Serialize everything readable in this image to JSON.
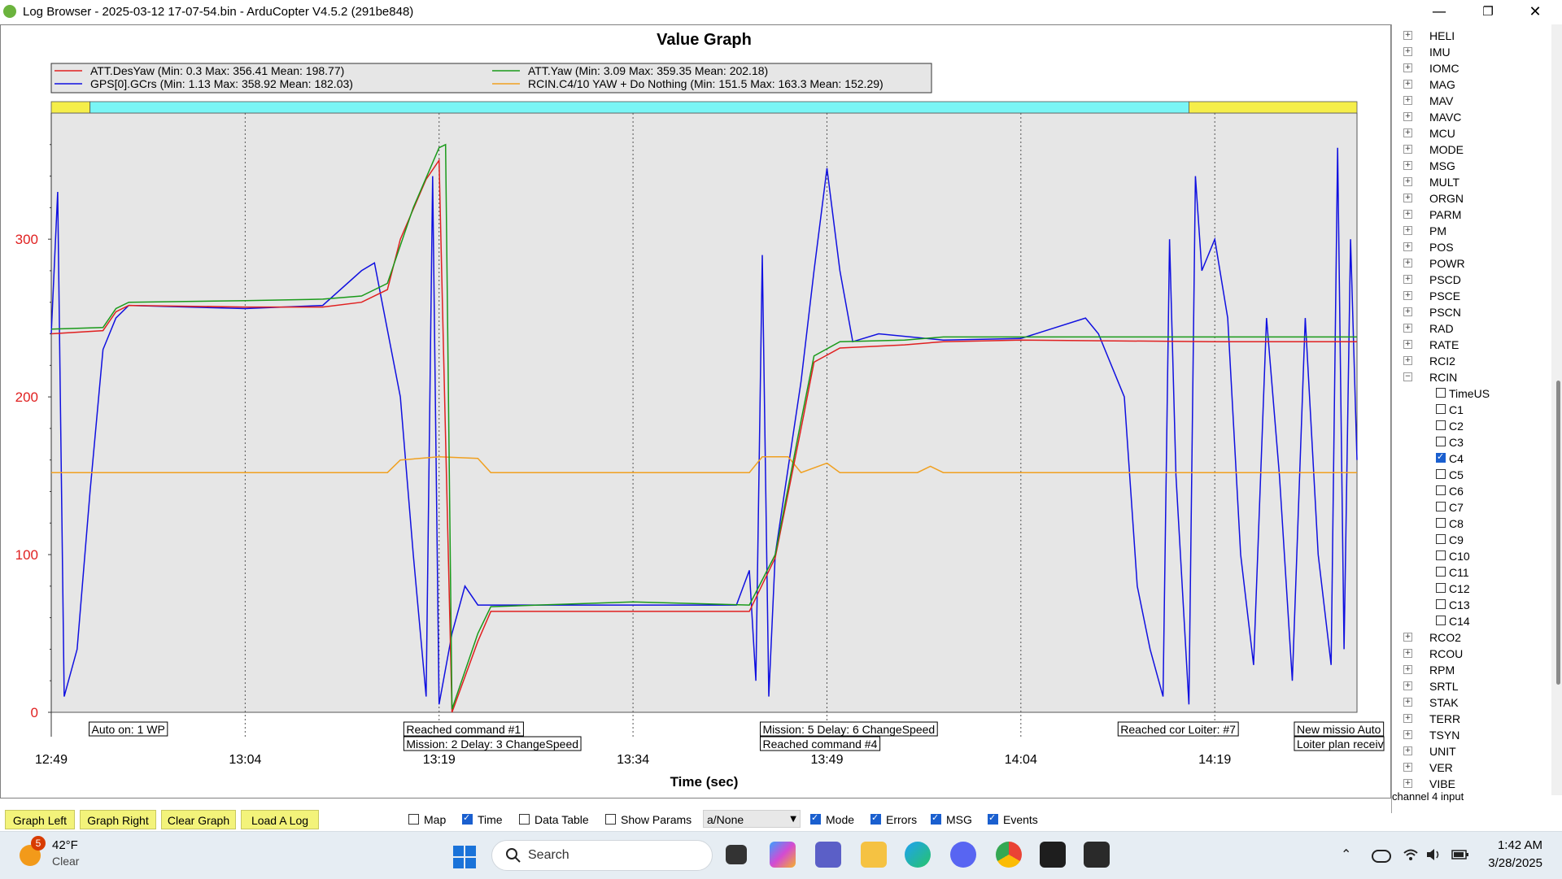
{
  "window": {
    "title": "Log Browser - 2025-03-12 17-07-54.bin - ArduCopter V4.5.2 (291be848)",
    "minimize": "—",
    "maximize": "❐",
    "close": "✕"
  },
  "graph": {
    "title": "Value Graph",
    "xlabel": "Time (sec)",
    "legend": [
      {
        "label": "ATT.DesYaw  (Min: 0.3 Max: 356.41 Mean: 198.77)",
        "color": "#e02020"
      },
      {
        "label": "ATT.Yaw  (Min: 3.09 Max: 359.35 Mean: 202.18)",
        "color": "#1a9a1a"
      },
      {
        "label": "GPS[0].GCrs  (Min: 1.13 Max: 358.92 Mean: 182.03)",
        "color": "#1010e0"
      },
      {
        "label": "RCIN.C4/10 YAW + Do Nothing (Min: 151.5 Max: 163.3 Mean: 152.29)",
        "color": "#f0a020"
      }
    ],
    "annotations": [
      {
        "lines": [
          "Auto on: 1 WP"
        ],
        "x": 0.029
      },
      {
        "lines": [
          "Reached command #1",
          "Mission: 2 Delay: 3 ChangeSpeed"
        ],
        "x": 0.27
      },
      {
        "lines": [
          "Mission: 5 Delay: 6 ChangeSpeed",
          "Reached command #4"
        ],
        "x": 0.543
      },
      {
        "lines": [
          "Reached cor Loiter: #7"
        ],
        "x": 0.817
      },
      {
        "lines": [
          "New missio Auto",
          "Loiter plan receiv"
        ],
        "x": 0.952
      }
    ]
  },
  "chart_data": {
    "type": "line",
    "title": "Value Graph",
    "xlabel": "Time (sec)",
    "ylabel": "",
    "x_ticks": [
      "12:49",
      "13:04",
      "13:19",
      "13:34",
      "13:49",
      "14:04",
      "14:19"
    ],
    "y_ticks": [
      0,
      100,
      200,
      300
    ],
    "xlim": [
      "12:49",
      "14:30"
    ],
    "ylim": [
      0,
      380
    ],
    "grid": "vertical dotted",
    "mode_bar": [
      {
        "from": "12:49",
        "to": "12:52",
        "color": "#f5ee4a"
      },
      {
        "from": "12:52",
        "to": "14:17",
        "color": "#7af5f5"
      },
      {
        "from": "14:17",
        "to": "14:30",
        "color": "#f5ee4a"
      }
    ],
    "series": [
      {
        "name": "ATT.DesYaw",
        "color": "#e02020",
        "points": [
          [
            "12:49",
            240
          ],
          [
            "12:53",
            242
          ],
          [
            "12:54",
            254
          ],
          [
            "12:55",
            258
          ],
          [
            "13:04",
            257
          ],
          [
            "13:10",
            257
          ],
          [
            "13:13",
            260
          ],
          [
            "13:15",
            268
          ],
          [
            "13:16",
            300
          ],
          [
            "13:18",
            338
          ],
          [
            "13:19",
            350
          ],
          [
            "13:20",
            0
          ],
          [
            "13:22",
            45
          ],
          [
            "13:23",
            64
          ],
          [
            "13:34",
            64
          ],
          [
            "13:43",
            64
          ],
          [
            "13:45",
            98
          ],
          [
            "13:47",
            180
          ],
          [
            "13:48",
            222
          ],
          [
            "13:50",
            231
          ],
          [
            "13:55",
            233
          ],
          [
            "13:58",
            235
          ],
          [
            "14:04",
            236
          ],
          [
            "14:19",
            235
          ],
          [
            "14:30",
            235
          ]
        ]
      },
      {
        "name": "ATT.Yaw",
        "color": "#1a9a1a",
        "points": [
          [
            "12:49",
            243
          ],
          [
            "12:53",
            244
          ],
          [
            "12:54",
            256
          ],
          [
            "12:55",
            260
          ],
          [
            "13:04",
            261
          ],
          [
            "13:10",
            262
          ],
          [
            "13:13",
            264
          ],
          [
            "13:15",
            272
          ],
          [
            "13:17",
            320
          ],
          [
            "13:19",
            358
          ],
          [
            "13:19.5",
            360
          ],
          [
            "13:20",
            2
          ],
          [
            "13:22",
            50
          ],
          [
            "13:23",
            67
          ],
          [
            "13:34",
            70
          ],
          [
            "13:43",
            68
          ],
          [
            "13:45",
            100
          ],
          [
            "13:47",
            185
          ],
          [
            "13:48",
            226
          ],
          [
            "13:50",
            235
          ],
          [
            "13:55",
            236
          ],
          [
            "13:58",
            238
          ],
          [
            "14:04",
            238
          ],
          [
            "14:19",
            238
          ],
          [
            "14:30",
            238
          ]
        ]
      },
      {
        "name": "GPS[0].GCrs",
        "color": "#1010e0",
        "points": [
          [
            "12:49",
            240
          ],
          [
            "12:49.5",
            330
          ],
          [
            "12:50",
            10
          ],
          [
            "12:51",
            40
          ],
          [
            "12:52",
            140
          ],
          [
            "12:53",
            230
          ],
          [
            "12:54",
            250
          ],
          [
            "12:55",
            258
          ],
          [
            "13:04",
            256
          ],
          [
            "13:10",
            258
          ],
          [
            "13:13",
            280
          ],
          [
            "13:14",
            285
          ],
          [
            "13:16",
            200
          ],
          [
            "13:17",
            100
          ],
          [
            "13:18",
            10
          ],
          [
            "13:18.5",
            340
          ],
          [
            "13:19",
            5
          ],
          [
            "13:20",
            50
          ],
          [
            "13:21",
            80
          ],
          [
            "13:22",
            68
          ],
          [
            "13:34",
            68
          ],
          [
            "13:42",
            68
          ],
          [
            "13:43",
            90
          ],
          [
            "13:43.5",
            20
          ],
          [
            "13:44",
            290
          ],
          [
            "13:44.5",
            10
          ],
          [
            "13:45",
            100
          ],
          [
            "13:47",
            210
          ],
          [
            "13:48",
            280
          ],
          [
            "13:49",
            345
          ],
          [
            "13:50",
            280
          ],
          [
            "13:51",
            235
          ],
          [
            "13:53",
            240
          ],
          [
            "13:58",
            236
          ],
          [
            "14:04",
            237
          ],
          [
            "14:09",
            250
          ],
          [
            "14:10",
            240
          ],
          [
            "14:12",
            200
          ],
          [
            "14:13",
            80
          ],
          [
            "14:14",
            40
          ],
          [
            "14:15",
            10
          ],
          [
            "14:15.5",
            300
          ],
          [
            "14:16",
            150
          ],
          [
            "14:17",
            5
          ],
          [
            "14:17.5",
            340
          ],
          [
            "14:18",
            280
          ],
          [
            "14:19",
            300
          ],
          [
            "14:20",
            250
          ],
          [
            "14:21",
            100
          ],
          [
            "14:22",
            30
          ],
          [
            "14:23",
            250
          ],
          [
            "14:24",
            150
          ],
          [
            "14:25",
            20
          ],
          [
            "14:26",
            250
          ],
          [
            "14:27",
            100
          ],
          [
            "14:28",
            30
          ],
          [
            "14:28.5",
            358
          ],
          [
            "14:29",
            40
          ],
          [
            "14:29.5",
            300
          ],
          [
            "14:30",
            160
          ]
        ]
      },
      {
        "name": "RCIN.C4/10 YAW + Do Nothing",
        "color": "#f0a020",
        "points": [
          [
            "12:49",
            152
          ],
          [
            "13:15",
            152
          ],
          [
            "13:16",
            160
          ],
          [
            "13:19",
            162
          ],
          [
            "13:22",
            161
          ],
          [
            "13:23",
            152
          ],
          [
            "13:43",
            152
          ],
          [
            "13:44",
            162
          ],
          [
            "13:46",
            162
          ],
          [
            "13:47",
            152
          ],
          [
            "13:49",
            158
          ],
          [
            "13:50",
            152
          ],
          [
            "13:56",
            152
          ],
          [
            "13:57",
            156
          ],
          [
            "13:58",
            152
          ],
          [
            "14:19",
            152
          ],
          [
            "14:30",
            152
          ]
        ]
      }
    ]
  },
  "tree": {
    "items": [
      {
        "label": "HELI",
        "type": "node"
      },
      {
        "label": "IMU",
        "type": "node"
      },
      {
        "label": "IOMC",
        "type": "node"
      },
      {
        "label": "MAG",
        "type": "node"
      },
      {
        "label": "MAV",
        "type": "node"
      },
      {
        "label": "MAVC",
        "type": "node"
      },
      {
        "label": "MCU",
        "type": "node"
      },
      {
        "label": "MODE",
        "type": "node"
      },
      {
        "label": "MSG",
        "type": "node"
      },
      {
        "label": "MULT",
        "type": "node"
      },
      {
        "label": "ORGN",
        "type": "node"
      },
      {
        "label": "PARM",
        "type": "node"
      },
      {
        "label": "PM",
        "type": "node"
      },
      {
        "label": "POS",
        "type": "node"
      },
      {
        "label": "POWR",
        "type": "node"
      },
      {
        "label": "PSCD",
        "type": "node"
      },
      {
        "label": "PSCE",
        "type": "node"
      },
      {
        "label": "PSCN",
        "type": "node"
      },
      {
        "label": "RAD",
        "type": "node"
      },
      {
        "label": "RATE",
        "type": "node"
      },
      {
        "label": "RCI2",
        "type": "node"
      },
      {
        "label": "RCIN",
        "type": "open"
      },
      {
        "label": "TimeUS",
        "type": "leaf",
        "checked": false
      },
      {
        "label": "C1",
        "type": "leaf",
        "checked": false
      },
      {
        "label": "C2",
        "type": "leaf",
        "checked": false
      },
      {
        "label": "C3",
        "type": "leaf",
        "checked": false
      },
      {
        "label": "C4",
        "type": "leaf",
        "checked": true
      },
      {
        "label": "C5",
        "type": "leaf",
        "checked": false
      },
      {
        "label": "C6",
        "type": "leaf",
        "checked": false
      },
      {
        "label": "C7",
        "type": "leaf",
        "checked": false
      },
      {
        "label": "C8",
        "type": "leaf",
        "checked": false
      },
      {
        "label": "C9",
        "type": "leaf",
        "checked": false
      },
      {
        "label": "C10",
        "type": "leaf",
        "checked": false
      },
      {
        "label": "C11",
        "type": "leaf",
        "checked": false
      },
      {
        "label": "C12",
        "type": "leaf",
        "checked": false
      },
      {
        "label": "C13",
        "type": "leaf",
        "checked": false
      },
      {
        "label": "C14",
        "type": "leaf",
        "checked": false
      },
      {
        "label": "RCO2",
        "type": "node"
      },
      {
        "label": "RCOU",
        "type": "node"
      },
      {
        "label": "RPM",
        "type": "node"
      },
      {
        "label": "SRTL",
        "type": "node"
      },
      {
        "label": "STAK",
        "type": "node"
      },
      {
        "label": "TERR",
        "type": "node"
      },
      {
        "label": "TSYN",
        "type": "node"
      },
      {
        "label": "UNIT",
        "type": "node"
      },
      {
        "label": "VER",
        "type": "node"
      },
      {
        "label": "VIBE",
        "type": "node"
      }
    ],
    "status": "channel 4 input"
  },
  "bottom": {
    "buttons": [
      "Graph Left",
      "Graph Right",
      "Clear Graph",
      "Load A Log"
    ],
    "checkboxes": [
      {
        "label": "Map",
        "checked": false
      },
      {
        "label": "Time",
        "checked": true
      },
      {
        "label": "Data Table",
        "checked": false
      },
      {
        "label": "Show Params",
        "checked": false
      }
    ],
    "combo_value": "a/None",
    "checkboxes2": [
      {
        "label": "Mode",
        "checked": true
      },
      {
        "label": "Errors",
        "checked": true
      },
      {
        "label": "MSG",
        "checked": true
      },
      {
        "label": "Events",
        "checked": true
      }
    ]
  },
  "taskbar": {
    "weather_badge": "5",
    "weather_temp": "42°F",
    "weather_cond": "Clear",
    "search_placeholder": "Search",
    "time": "1:42 AM",
    "date": "3/28/2025"
  }
}
